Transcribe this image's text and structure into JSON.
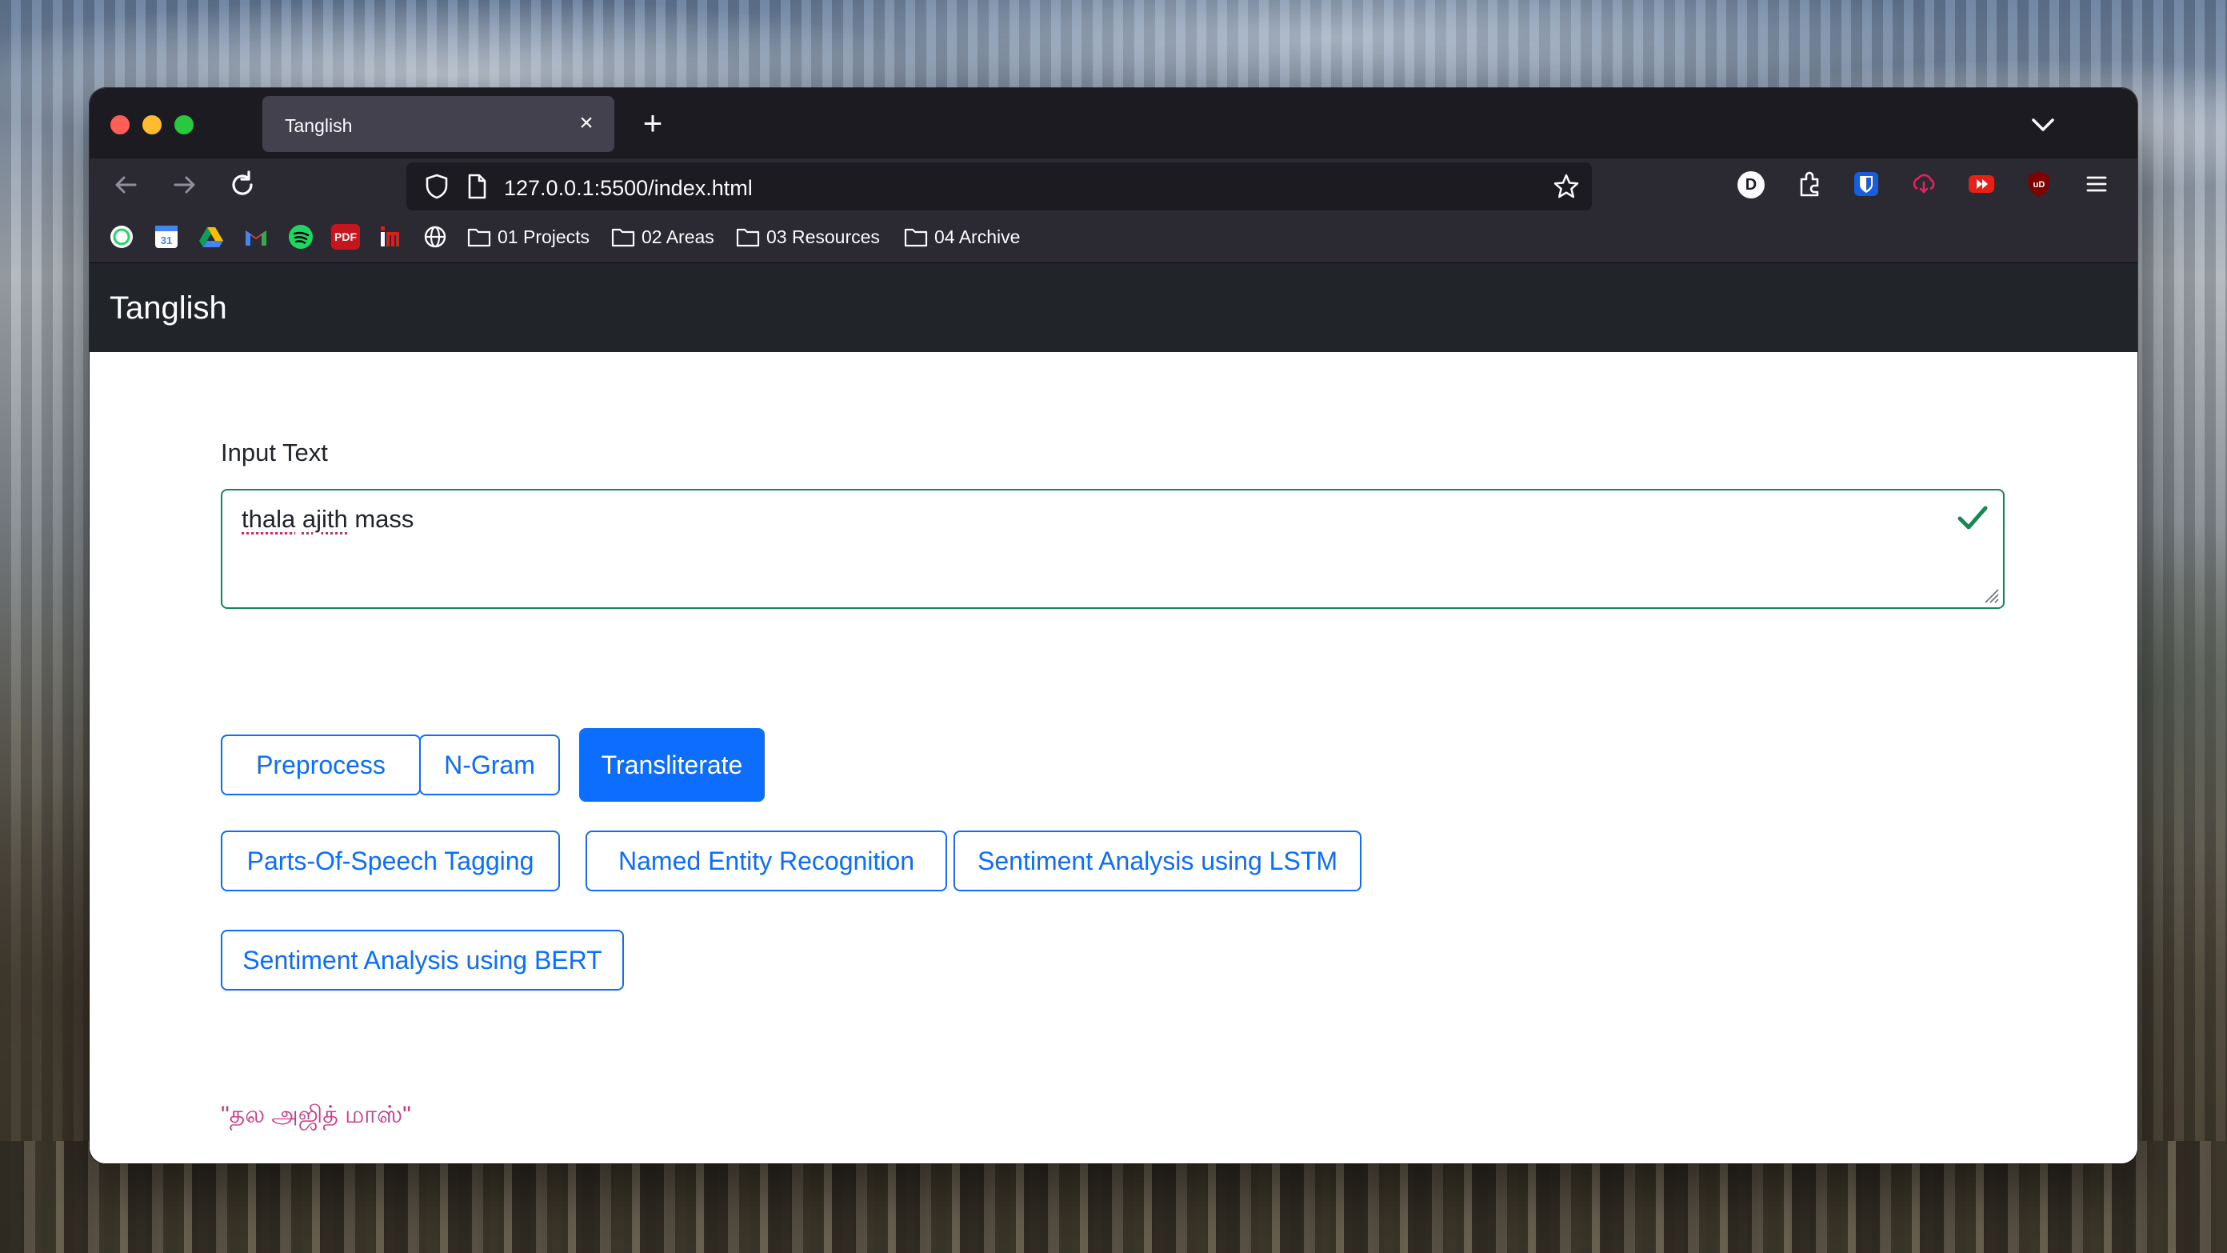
{
  "browser": {
    "tab_title": "Tanglish",
    "tab_close": "×",
    "new_tab": "+",
    "url": "127.0.0.1:5500/index.html",
    "bookmarks": [
      {
        "label": "01 Projects"
      },
      {
        "label": "02 Areas"
      },
      {
        "label": "03 Resources"
      },
      {
        "label": "04 Archive"
      }
    ],
    "bookmark_icons": [
      "whatsapp-icon",
      "google-calendar-icon",
      "google-drive-icon",
      "gmail-icon",
      "spotify-icon",
      "pdf-icon",
      "imdb-icon",
      "globe-icon"
    ],
    "calendar_day": "31",
    "pdf_label": "PDF",
    "ext_d_label": "D",
    "ext_ublock_label": "uD"
  },
  "app": {
    "brand": "Tanglish",
    "input_label": "Input Text",
    "input_value_words": [
      "thala",
      "ajith",
      "mass"
    ],
    "buttons": {
      "preprocess": "Preprocess",
      "ngram": "N-Gram",
      "transliterate": "Transliterate",
      "pos": "Parts-Of-Speech Tagging",
      "ner": "Named Entity Recognition",
      "sentiment_lstm": "Sentiment Analysis using LSTM",
      "sentiment_bert": "Sentiment Analysis using BERT"
    },
    "output": "\"தல அஜித் மாஸ்\""
  },
  "colors": {
    "primary": "#0d6efd",
    "valid": "#198754",
    "output_text": "#d63384",
    "navbar": "#212529"
  }
}
